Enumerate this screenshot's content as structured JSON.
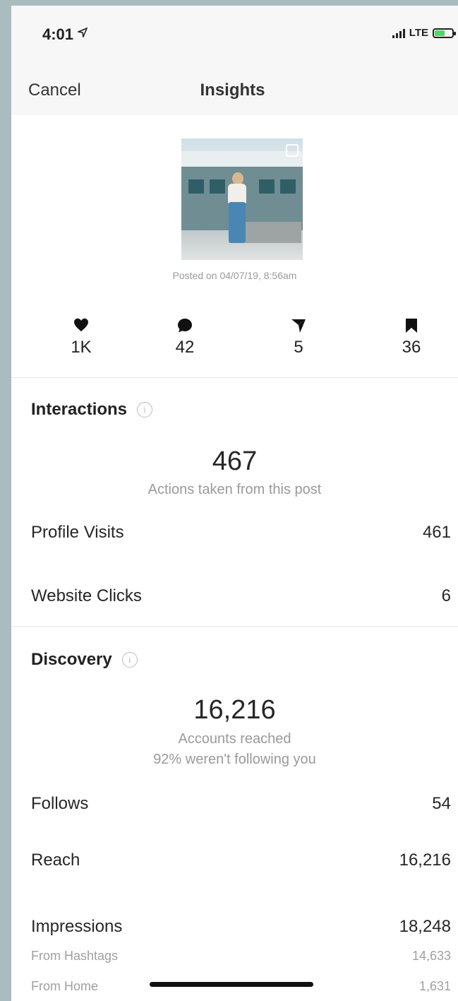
{
  "status_bar": {
    "time": "4:01",
    "network": "LTE"
  },
  "nav": {
    "cancel_label": "Cancel",
    "title": "Insights"
  },
  "post": {
    "posted_text": "Posted on 04/07/19, 8:56am"
  },
  "engagement": [
    {
      "icon": "heart-icon",
      "value": "1K"
    },
    {
      "icon": "comment-icon",
      "value": "42"
    },
    {
      "icon": "share-icon",
      "value": "5"
    },
    {
      "icon": "bookmark-icon",
      "value": "36"
    }
  ],
  "interactions": {
    "title": "Interactions",
    "total": "467",
    "caption": "Actions taken from this post",
    "rows": [
      {
        "label": "Profile Visits",
        "value": "461"
      },
      {
        "label": "Website Clicks",
        "value": "6"
      }
    ]
  },
  "discovery": {
    "title": "Discovery",
    "total": "16,216",
    "caption_1": "Accounts reached",
    "caption_2": "92% weren't following you",
    "rows": [
      {
        "label": "Follows",
        "value": "54"
      },
      {
        "label": "Reach",
        "value": "16,216"
      },
      {
        "label": "Impressions",
        "value": "18,248"
      }
    ],
    "sub_rows": [
      {
        "label": "From Hashtags",
        "value": "14,633"
      },
      {
        "label": "From Home",
        "value": "1,631"
      }
    ]
  },
  "colors": {
    "background": "#a9bcc0",
    "battery": "#4cd964"
  }
}
